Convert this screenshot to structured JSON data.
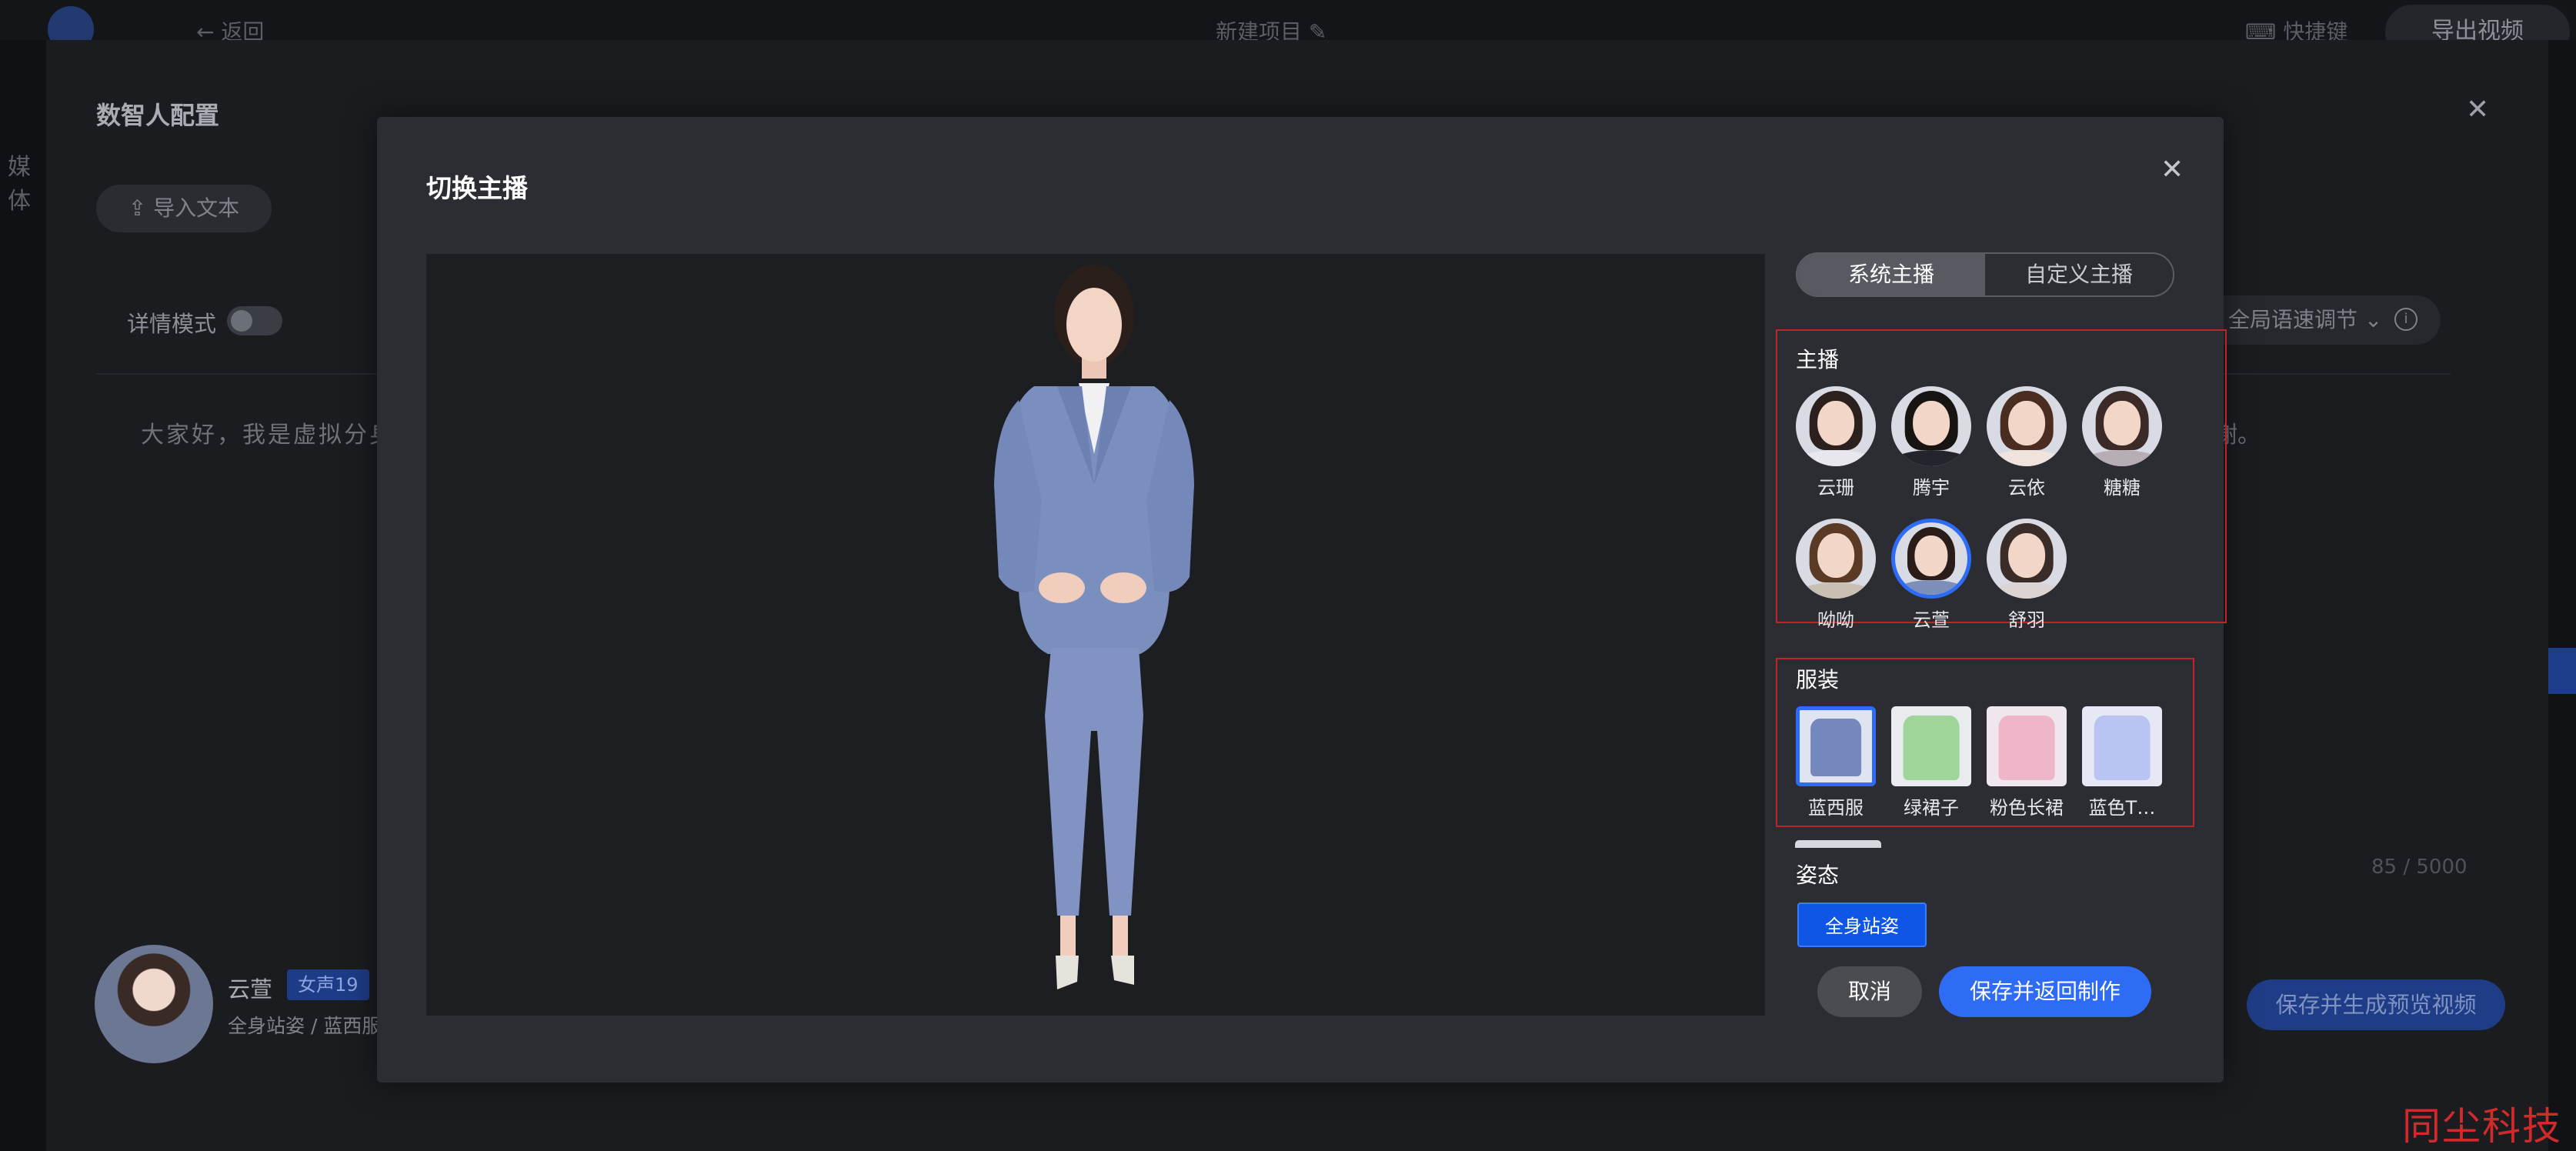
{
  "topbar": {
    "back_label": "返回",
    "project_name": "新建项目",
    "shortcut_label": "快捷键",
    "export_label": "导出视频"
  },
  "left_strip": {
    "label": "媒体"
  },
  "config": {
    "title": "数智人配置",
    "import_label": "导入文本",
    "detail_mode_label": "详情模式",
    "detail_mode_on": false,
    "script_text": "大家好，我是虚拟分身",
    "script_tail": "谢。",
    "speed_label": "全局语速调节",
    "counter": "85 / 5000",
    "generate_label": "保存并生成预览视频",
    "current": {
      "name": "云萱",
      "voice": "女声19",
      "detail": "全身站姿 / 蓝西服"
    }
  },
  "modal": {
    "title": "切换主播",
    "tabs": [
      {
        "label": "系统主播",
        "active": true
      },
      {
        "label": "自定义主播",
        "active": false
      }
    ],
    "anchor_section": {
      "label": "主播",
      "items": [
        {
          "name": "云珊",
          "selected": false,
          "hair": "#2b201c",
          "outfit": "#e9e7ee"
        },
        {
          "name": "腾宇",
          "selected": false,
          "hair": "#171412",
          "outfit": "#22252c"
        },
        {
          "name": "云依",
          "selected": false,
          "hair": "#4a2c20",
          "outfit": "#efe3dc"
        },
        {
          "name": "糖糖",
          "selected": false,
          "hair": "#3b2a28",
          "outfit": "#b7adb5"
        },
        {
          "name": "呦呦",
          "selected": false,
          "hair": "#5a3a24",
          "outfit": "#c9c0b4"
        },
        {
          "name": "云萱",
          "selected": true,
          "hair": "#2a1d19",
          "outfit": "#7d8fb8"
        },
        {
          "name": "舒羽",
          "selected": false,
          "hair": "#3a2c28",
          "outfit": "#dcd4d2"
        }
      ]
    },
    "clothing_section": {
      "label": "服装",
      "items": [
        {
          "name": "蓝西服",
          "selected": true,
          "color": "#7488bd",
          "bg": "#dfe4f0"
        },
        {
          "name": "绿裙子",
          "selected": false,
          "color": "#9fd49a",
          "bg": "#e8ecef"
        },
        {
          "name": "粉色长裙",
          "selected": false,
          "color": "#efb6c9",
          "bg": "#f0e7ee"
        },
        {
          "name": "蓝色T…",
          "selected": false,
          "color": "#b9c4f2",
          "bg": "#e6e9f5"
        }
      ]
    },
    "posture_section": {
      "label": "姿态",
      "selected": "全身站姿"
    },
    "cancel_label": "取消",
    "save_label": "保存并返回制作",
    "accent": "#2f6cf6",
    "highlight_border": "#c0232b"
  },
  "watermark": "同尘科技"
}
